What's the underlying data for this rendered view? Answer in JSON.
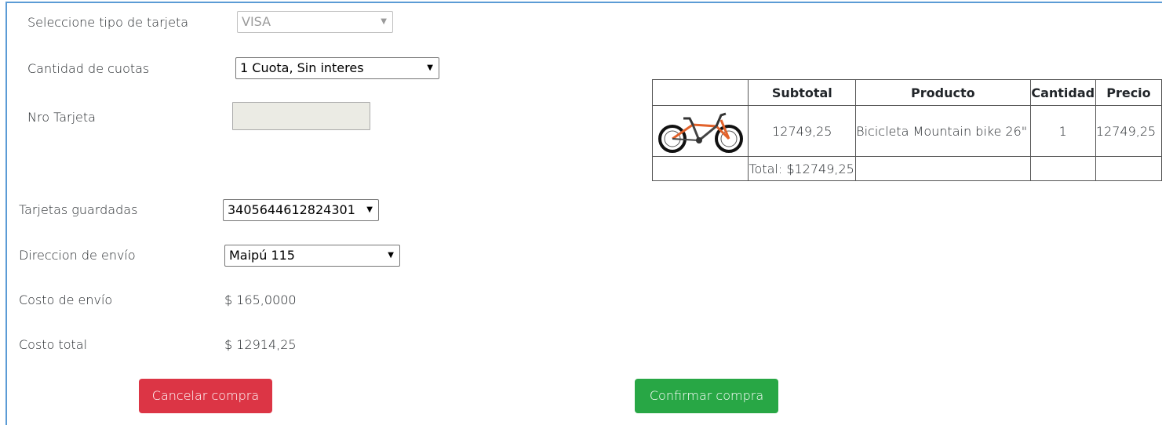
{
  "payment": {
    "card_type_label": "Seleccione tipo de tarjeta",
    "card_type_value": "VISA",
    "installments_label": "Cantidad de cuotas",
    "installments_value": "1 Cuota, Sin interes",
    "card_number_label": "Nro Tarjeta",
    "card_number_value": "",
    "saved_cards_label": "Tarjetas guardadas",
    "saved_cards_value": "3405644612824301",
    "shipping_address_label": "Direccion de envío",
    "shipping_address_value": "Maipú 115",
    "shipping_cost_label": "Costo de envío",
    "shipping_cost_value": "$ 165,0000",
    "total_cost_label": "Costo total",
    "total_cost_value": "$ 12914,25"
  },
  "cart": {
    "headers": [
      "",
      "Subtotal",
      "Producto",
      "Cantidad",
      "Precio"
    ],
    "rows": [
      {
        "image": "bicycle-image",
        "subtotal": "12749,25",
        "product": "Bicicleta Mountain bike 26\"",
        "quantity": "1",
        "price": "12749,25"
      }
    ],
    "total": "Total: $12749,25"
  },
  "actions": {
    "cancel_label": "Cancelar compra",
    "confirm_label": "Confirmar compra"
  },
  "colors": {
    "frame_border": "#5b9bd5",
    "cancel_button": "#dc3545",
    "confirm_button": "#28a745"
  }
}
